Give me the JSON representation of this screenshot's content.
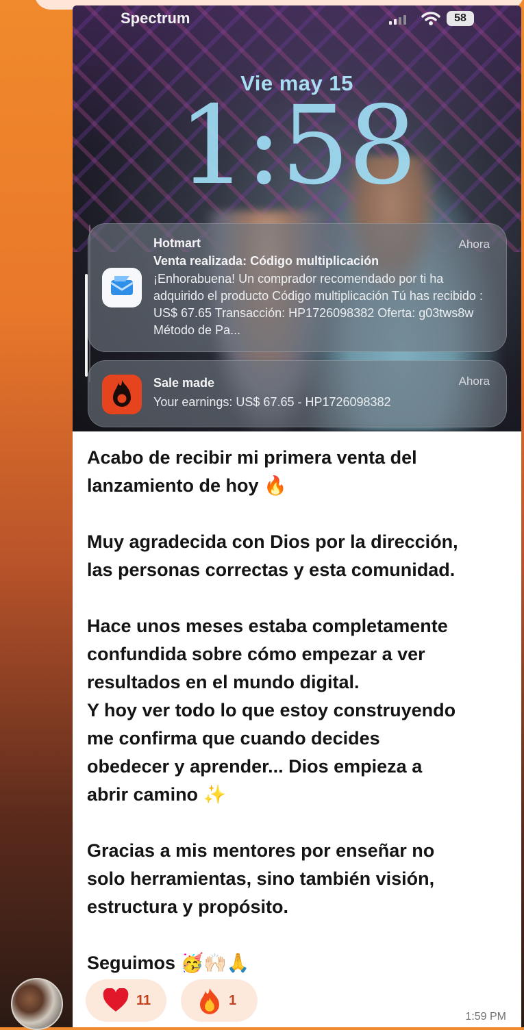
{
  "status_bar": {
    "carrier": "Spectrum",
    "battery": "58"
  },
  "lockscreen": {
    "date": "Vie may 15",
    "time": "1:58"
  },
  "notifications": [
    {
      "app": "Hotmart",
      "time": "Ahora",
      "title": "Venta realizada: Código multiplicación",
      "body": "¡Enhorabuena! Un comprador recomendado por ti ha adquirido el producto Código multiplicación Tú has recibido : US$ 67.65 Transacción: HP1726098382 Oferta: g03tws8w Método de Pa...",
      "icon": "hotmart-envelope-icon"
    },
    {
      "app": "Sale made",
      "time": "Ahora",
      "title": "",
      "body": "Your earnings: US$ 67.65 - HP1726098382",
      "icon": "hotmart-flame-icon"
    }
  ],
  "message": {
    "p1_line1": "Acabo de recibir mi primera venta del",
    "p1_line2": "lanzamiento de hoy",
    "p1_emoji": "🔥",
    "p2_line1": "Muy agradecida con Dios por la dirección,",
    "p2_line2": "las personas correctas y esta comunidad.",
    "p3_line1": "Hace unos meses estaba completamente",
    "p3_line2": "confundida sobre cómo empezar a ver",
    "p3_line3": "resultados en el mundo digital.",
    "p3_line4": "Y hoy ver todo lo que estoy construyendo",
    "p3_line5": "me confirma que cuando decides",
    "p3_line6": "obedecer y aprender... Dios empieza a",
    "p3_line7": "abrir camino",
    "p3_emoji": "✨",
    "p4_line1": "Gracias a mis mentores por enseñar no",
    "p4_line2": "solo herramientas, sino también visión,",
    "p4_line3": "estructura y propósito.",
    "p5_line1": "Seguimos",
    "p5_emoji": "🥳🙌🏻🙏",
    "timestamp": "1:59 PM"
  },
  "reactions": [
    {
      "icon": "heart-icon",
      "count": "11"
    },
    {
      "icon": "fire-icon",
      "count": "1"
    }
  ],
  "colors": {
    "accent": "#c4411e",
    "reaction_bg": "#fce9dc",
    "clock": "#9fdcf3"
  }
}
